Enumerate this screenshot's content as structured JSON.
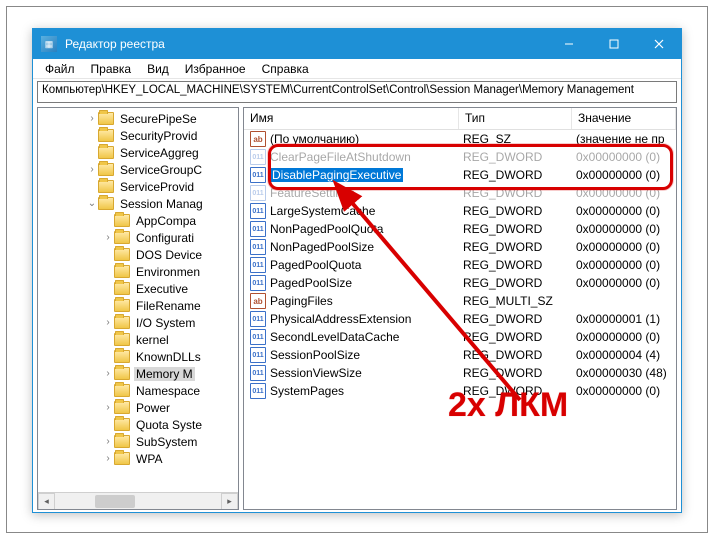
{
  "window": {
    "title": "Редактор реестра",
    "minimize_tip": "Свернуть",
    "maximize_tip": "Развернуть",
    "close_tip": "Закрыть"
  },
  "menu": {
    "file": "Файл",
    "edit": "Правка",
    "view": "Вид",
    "favorites": "Избранное",
    "help": "Справка"
  },
  "address": "Компьютер\\HKEY_LOCAL_MACHINE\\SYSTEM\\CurrentControlSet\\Control\\Session Manager\\Memory Management",
  "tree": {
    "items": [
      {
        "indent": 3,
        "twisty": ">",
        "label": "SecurePipeSe"
      },
      {
        "indent": 3,
        "twisty": "",
        "label": "SecurityProvid"
      },
      {
        "indent": 3,
        "twisty": "",
        "label": "ServiceAggreg"
      },
      {
        "indent": 3,
        "twisty": ">",
        "label": "ServiceGroupC"
      },
      {
        "indent": 3,
        "twisty": "",
        "label": "ServiceProvid"
      },
      {
        "indent": 3,
        "twisty": "v",
        "label": "Session Manag"
      },
      {
        "indent": 4,
        "twisty": "",
        "label": "AppCompa"
      },
      {
        "indent": 4,
        "twisty": ">",
        "label": "Configurati"
      },
      {
        "indent": 4,
        "twisty": "",
        "label": "DOS Device"
      },
      {
        "indent": 4,
        "twisty": "",
        "label": "Environmen"
      },
      {
        "indent": 4,
        "twisty": "",
        "label": "Executive"
      },
      {
        "indent": 4,
        "twisty": "",
        "label": "FileRename"
      },
      {
        "indent": 4,
        "twisty": ">",
        "label": "I/O System"
      },
      {
        "indent": 4,
        "twisty": "",
        "label": "kernel"
      },
      {
        "indent": 4,
        "twisty": "",
        "label": "KnownDLLs"
      },
      {
        "indent": 4,
        "twisty": ">",
        "label": "Memory M",
        "selected": true
      },
      {
        "indent": 4,
        "twisty": "",
        "label": "Namespace"
      },
      {
        "indent": 4,
        "twisty": ">",
        "label": "Power"
      },
      {
        "indent": 4,
        "twisty": "",
        "label": "Quota Syste"
      },
      {
        "indent": 4,
        "twisty": ">",
        "label": "SubSystem"
      },
      {
        "indent": 4,
        "twisty": ">",
        "label": "WPA"
      }
    ]
  },
  "list": {
    "columns": {
      "name": "Имя",
      "type": "Тип",
      "value": "Значение"
    },
    "rows": [
      {
        "icon": "sz",
        "name": "(По умолчанию)",
        "type": "REG_SZ",
        "value": "(значение не пр"
      },
      {
        "icon": "dw",
        "name": "ClearPageFileAtShutdown",
        "type": "REG_DWORD",
        "value": "0x00000000 (0)",
        "strike": true
      },
      {
        "icon": "dw",
        "name": "DisablePagingExecutive",
        "type": "REG_DWORD",
        "value": "0x00000000 (0)",
        "highlight": true
      },
      {
        "icon": "dw",
        "name": "FeatureSettings",
        "type": "REG_DWORD",
        "value": "0x00000000 (0)",
        "strike": true
      },
      {
        "icon": "dw",
        "name": "LargeSystemCache",
        "type": "REG_DWORD",
        "value": "0x00000000 (0)"
      },
      {
        "icon": "dw",
        "name": "NonPagedPoolQuota",
        "type": "REG_DWORD",
        "value": "0x00000000 (0)"
      },
      {
        "icon": "dw",
        "name": "NonPagedPoolSize",
        "type": "REG_DWORD",
        "value": "0x00000000 (0)"
      },
      {
        "icon": "dw",
        "name": "PagedPoolQuota",
        "type": "REG_DWORD",
        "value": "0x00000000 (0)"
      },
      {
        "icon": "dw",
        "name": "PagedPoolSize",
        "type": "REG_DWORD",
        "value": "0x00000000 (0)"
      },
      {
        "icon": "sz",
        "name": "PagingFiles",
        "type": "REG_MULTI_SZ",
        "value": ""
      },
      {
        "icon": "dw",
        "name": "PhysicalAddressExtension",
        "type": "REG_DWORD",
        "value": "0x00000001 (1)"
      },
      {
        "icon": "dw",
        "name": "SecondLevelDataCache",
        "type": "REG_DWORD",
        "value": "0x00000000 (0)"
      },
      {
        "icon": "dw",
        "name": "SessionPoolSize",
        "type": "REG_DWORD",
        "value": "0x00000004 (4)"
      },
      {
        "icon": "dw",
        "name": "SessionViewSize",
        "type": "REG_DWORD",
        "value": "0x00000030 (48)"
      },
      {
        "icon": "dw",
        "name": "SystemPages",
        "type": "REG_DWORD",
        "value": "0x00000000 (0)"
      }
    ]
  },
  "annotation": {
    "text": "2х ЛКМ"
  }
}
